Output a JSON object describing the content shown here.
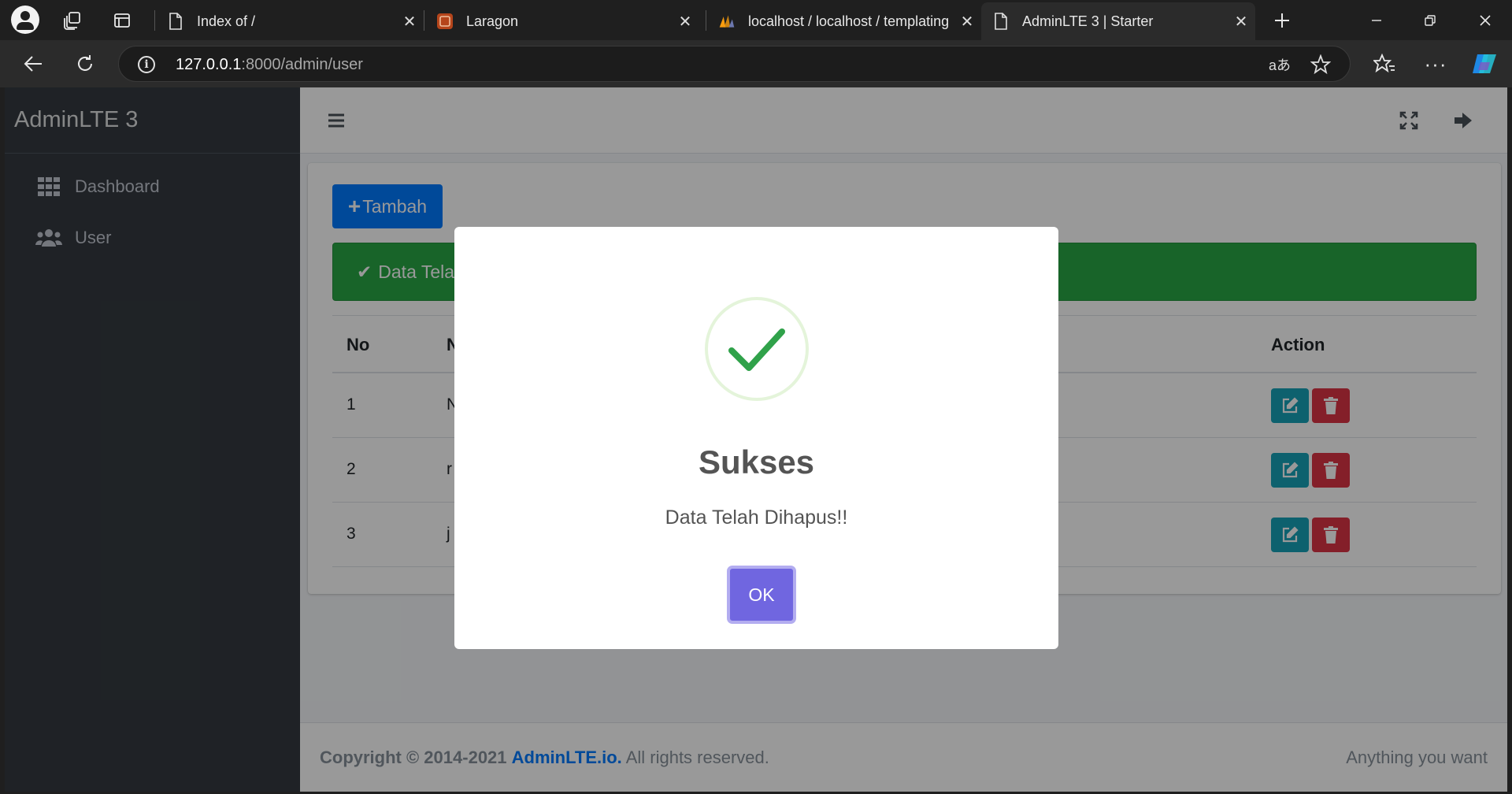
{
  "browser": {
    "tabs": [
      {
        "title": "Index of /",
        "icon": "page-icon",
        "active": false
      },
      {
        "title": "Laragon",
        "icon": "laragon-icon",
        "active": false
      },
      {
        "title": "localhost / localhost / templating",
        "icon": "phpmyadmin-icon",
        "active": false
      },
      {
        "title": "AdminLTE 3 | Starter",
        "icon": "page-icon",
        "active": true
      }
    ],
    "url_host": "127.0.0.1",
    "url_rest": ":8000/admin/user"
  },
  "sidebar": {
    "brand": "AdminLTE 3",
    "items": [
      {
        "label": "Dashboard",
        "icon": "grid-icon"
      },
      {
        "label": "User",
        "icon": "users-icon"
      }
    ]
  },
  "main": {
    "add_button": "Tambah",
    "alert_text": "Data Tela",
    "table": {
      "headers": {
        "no": "No",
        "name": "N",
        "action": "Action"
      },
      "rows": [
        {
          "no": "1",
          "name": "N"
        },
        {
          "no": "2",
          "name": "r"
        },
        {
          "no": "3",
          "name": "j"
        }
      ]
    }
  },
  "footer": {
    "copyright_prefix": "Copyright © 2014-2021",
    "copyright_link": "AdminLTE.io.",
    "copyright_suffix": "All rights reserved.",
    "right_text": "Anything you want"
  },
  "modal": {
    "title": "Sukses",
    "text": "Data Telah Dihapus!!",
    "ok_label": "OK",
    "icon": "success-check-icon"
  },
  "colors": {
    "primary": "#007bff",
    "success": "#28a745",
    "info": "#17a2b8",
    "danger": "#dc3545",
    "swal_confirm": "#7066e0",
    "sidebar_bg": "#343a40"
  }
}
